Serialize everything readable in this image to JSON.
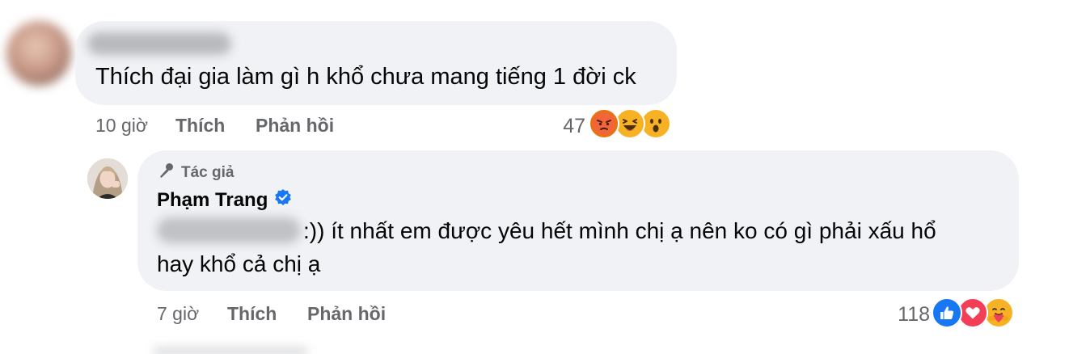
{
  "comment1": {
    "text": "Thích đại gia làm gì h khổ chưa mang tiếng 1 đời ck",
    "time": "10 giờ",
    "like_label": "Thích",
    "reply_label": "Phản hồi",
    "reaction_count": "47",
    "reactions": [
      "angry-emoji-icon",
      "haha-emoji-icon",
      "wow-emoji-icon"
    ]
  },
  "reply": {
    "badge": "Tác giả",
    "author": "Phạm Trang",
    "text_line1": ":)) ít nhất em được yêu hết mình chị ạ nên ko có gì phải xấu hổ",
    "text_line2": "hay khổ cả chị ạ",
    "time": "7 giờ",
    "like_label": "Thích",
    "reply_label": "Phản hồi",
    "reaction_count": "118",
    "reactions": [
      "like-icon",
      "love-icon",
      "care-emoji-icon"
    ]
  },
  "colors": {
    "bubble": "#f0f2f5",
    "meta": "#65676b",
    "verified": "#1877f2",
    "like": "#1877f2",
    "love": "#f33e58",
    "emoji_yellow": "#f7b125"
  }
}
